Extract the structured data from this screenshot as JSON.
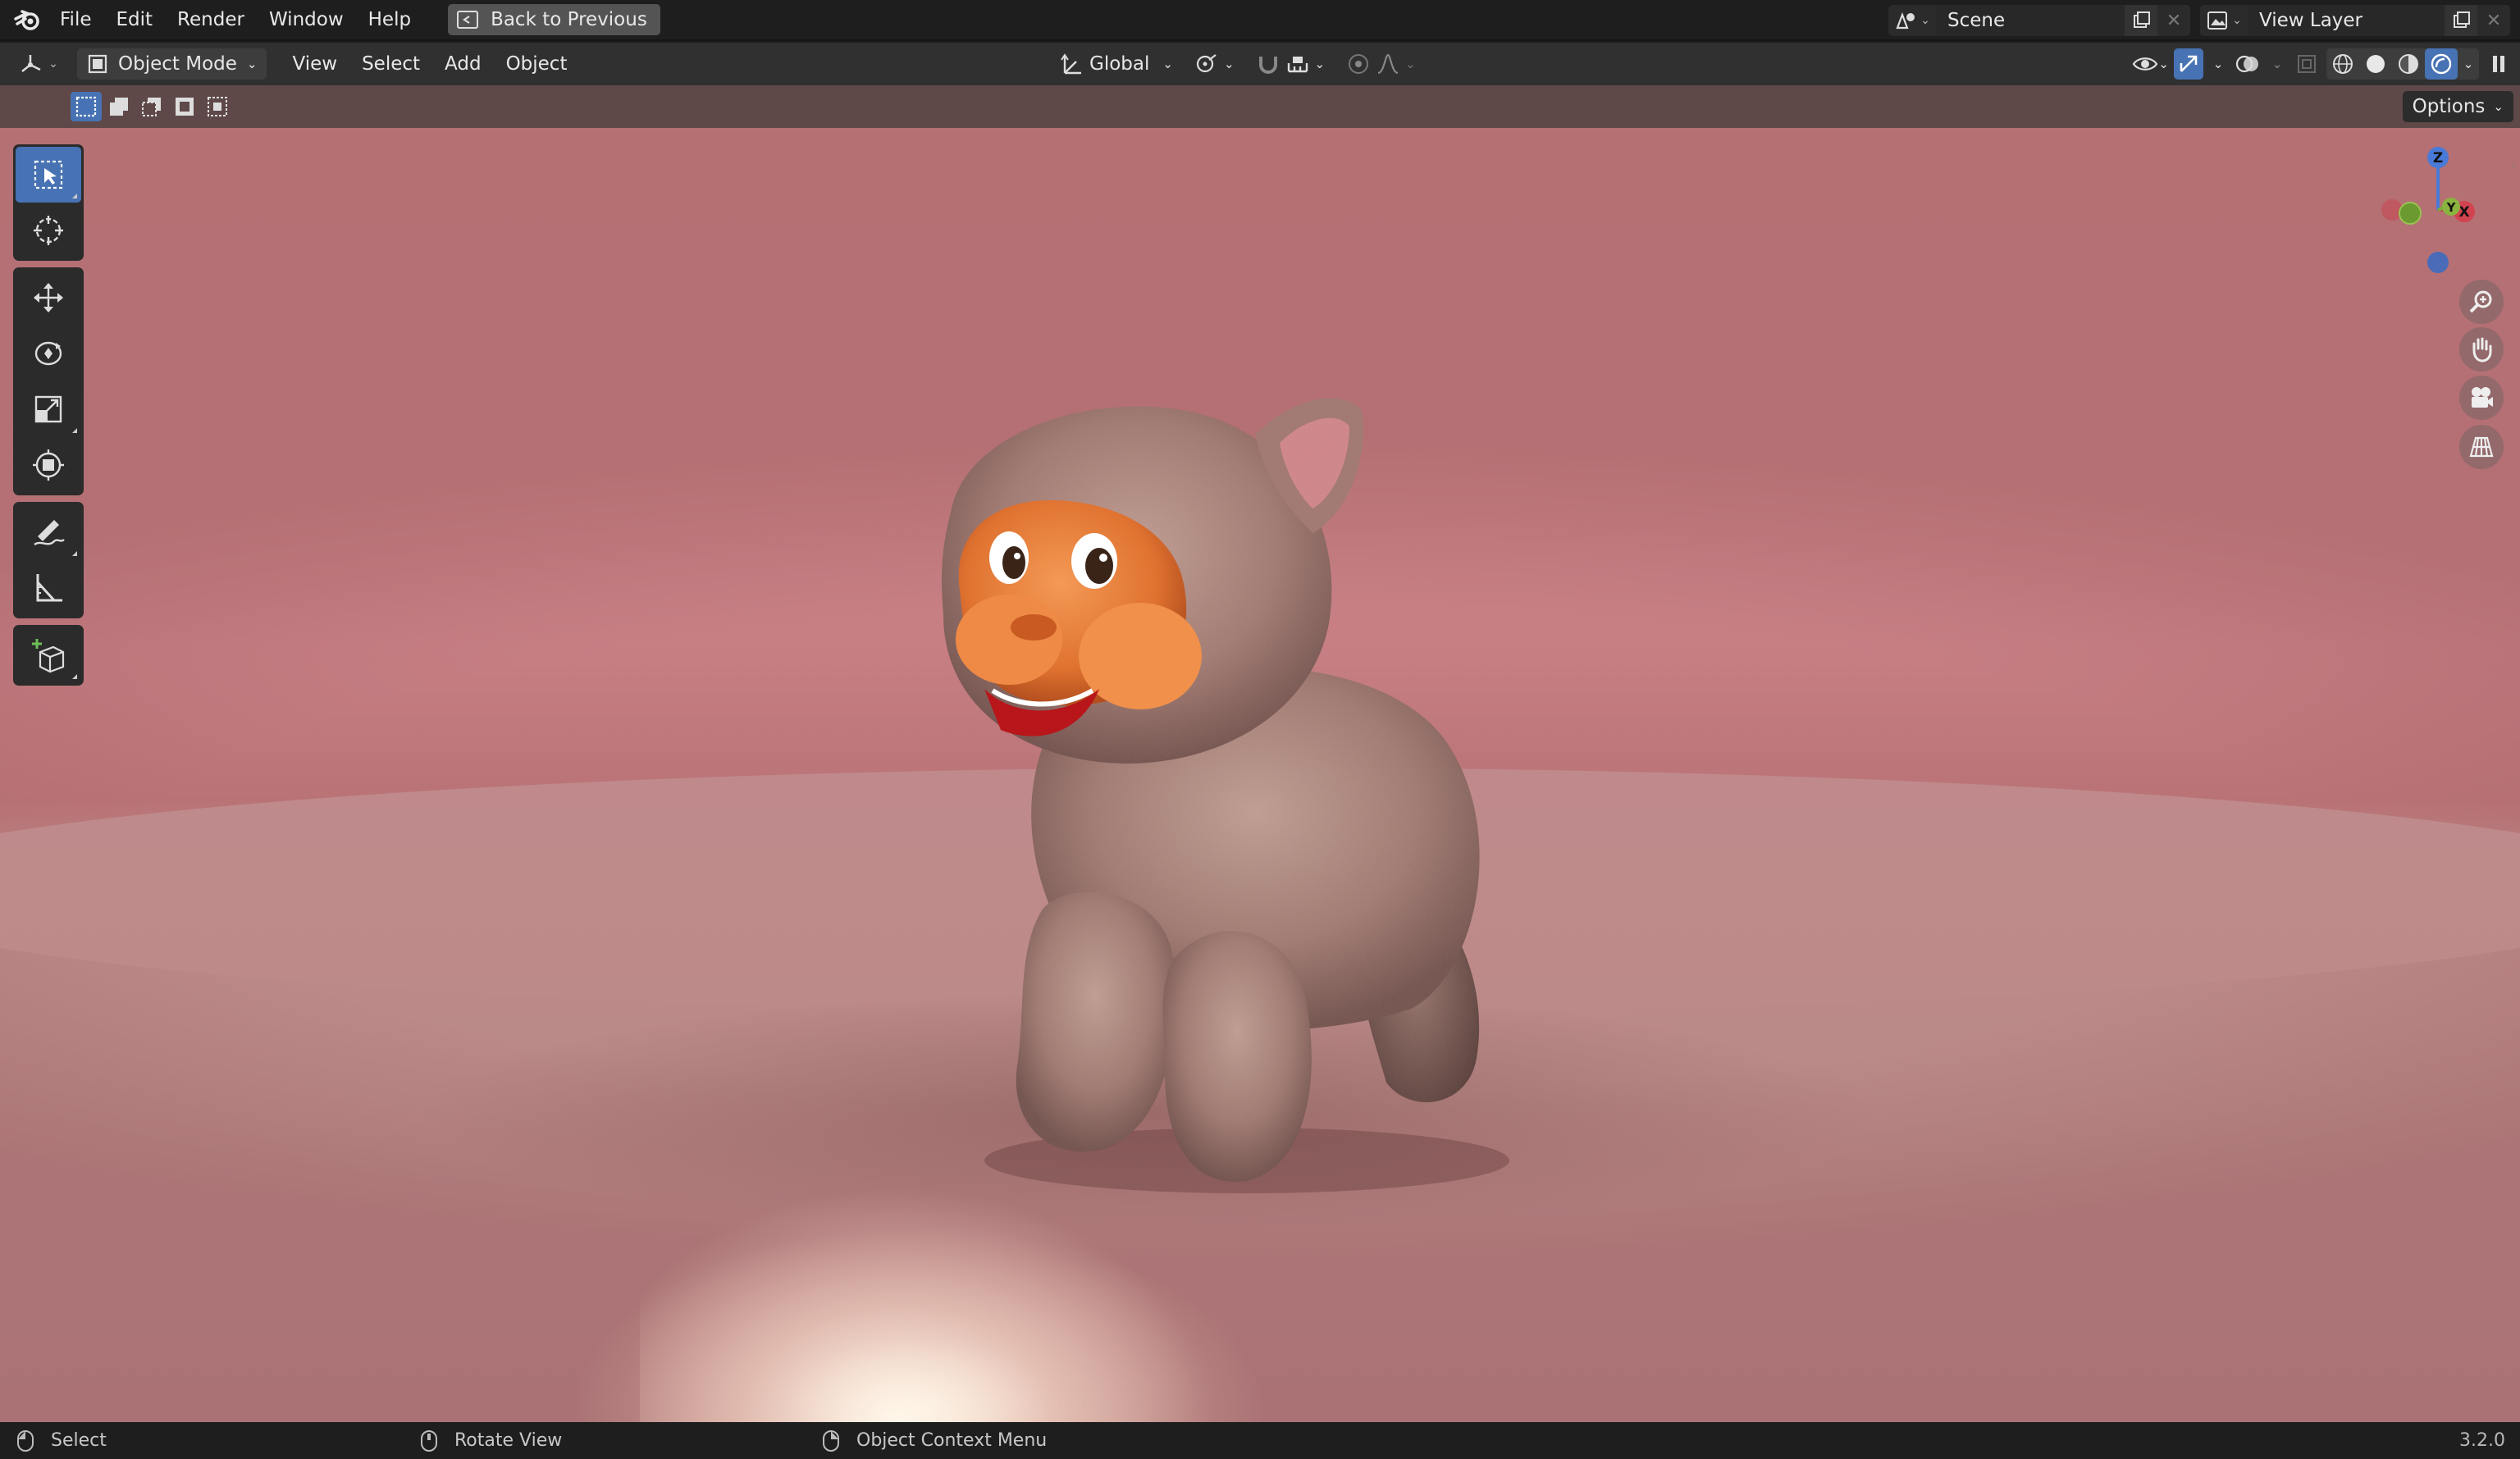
{
  "topbar": {
    "menus": [
      "File",
      "Edit",
      "Render",
      "Window",
      "Help"
    ],
    "back_button": "Back to Previous",
    "scene_name": "Scene",
    "view_layer_name": "View Layer"
  },
  "viewport_header": {
    "mode": "Object Mode",
    "menus": [
      "View",
      "Select",
      "Add",
      "Object"
    ],
    "orientation": "Global"
  },
  "tool_settings": {
    "options_label": "Options"
  },
  "toolbar": {
    "tools": [
      "select-box",
      "cursor",
      "move",
      "rotate",
      "scale",
      "transform",
      "annotate",
      "measure",
      "add-cube"
    ],
    "active": "select-box"
  },
  "gizmo": {
    "axes": [
      "Z",
      "Y",
      "X"
    ]
  },
  "statusbar": {
    "left": "Select",
    "middle": "Rotate View",
    "right": "Object Context Menu",
    "version": "3.2.0"
  },
  "colors": {
    "accent": "#4772b3",
    "viewport_bg": "#c98282",
    "tool_header": "#5f4848"
  }
}
